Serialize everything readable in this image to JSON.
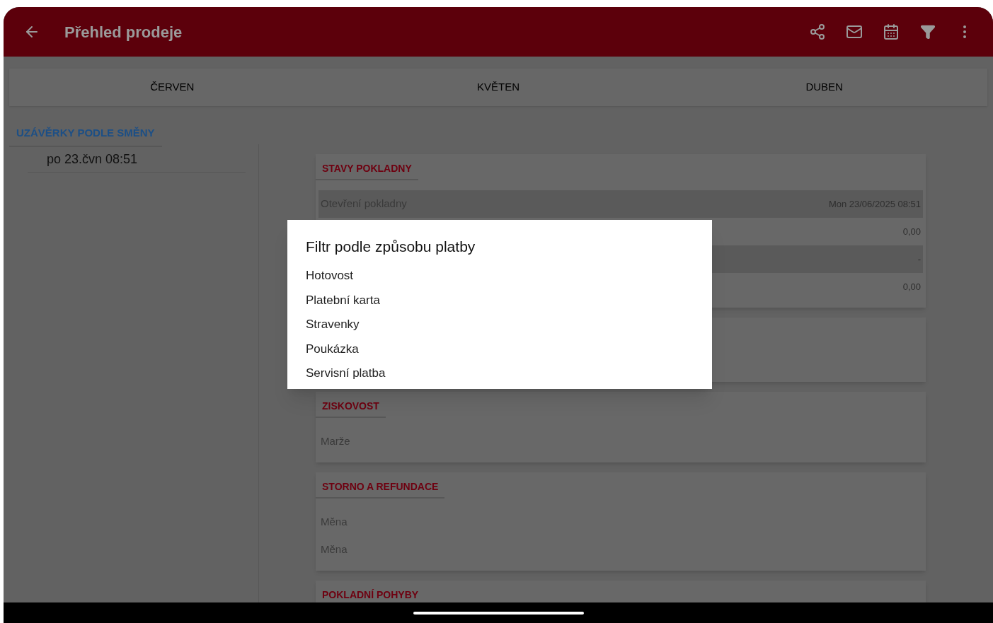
{
  "app_bar": {
    "title": "Přehled prodeje"
  },
  "tabs": [
    {
      "label": "ČERVEN"
    },
    {
      "label": "KVĚTEN"
    },
    {
      "label": "DUBEN"
    }
  ],
  "shifts": {
    "heading": "UZÁVĚRKY PODLE SMĚNY",
    "items": [
      {
        "label": "po 23.čvn 08:51"
      }
    ]
  },
  "cards": [
    {
      "kind": "section",
      "title": "STAVY POKLADNY",
      "rows": [
        {
          "label": "Otevření pokladny",
          "value": "Mon 23/06/2025 08:51",
          "shaded": true
        },
        {
          "value": "0,00",
          "shaded": false
        },
        {
          "value": "-",
          "shaded": true
        },
        {
          "value": "0,00",
          "shaded": false
        }
      ]
    },
    {
      "kind": "covered"
    },
    {
      "kind": "section",
      "title": "ZISKOVOST",
      "rows": [
        {
          "label": "Marže"
        }
      ]
    },
    {
      "kind": "section",
      "title": "STORNO A REFUNDACE",
      "rows": [
        {
          "label": "Měna"
        },
        {
          "label": "Měna"
        }
      ]
    },
    {
      "kind": "section",
      "title": "POKLADNÍ POHYBY"
    }
  ],
  "dialog": {
    "title": "Filtr podle způsobu platby",
    "options": [
      "Hotovost",
      "Platební karta",
      "Stravenky",
      "Poukázka",
      "Servisní platba"
    ]
  }
}
